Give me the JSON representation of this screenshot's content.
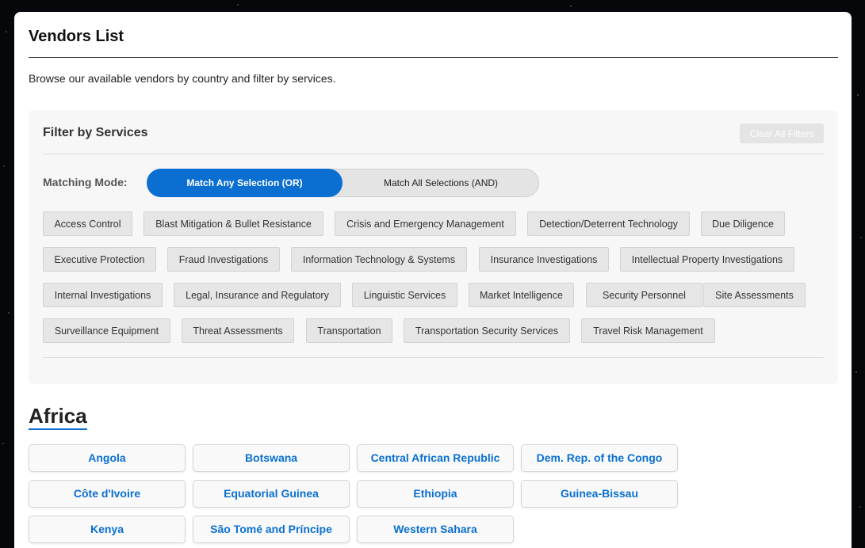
{
  "page": {
    "title": "Vendors List",
    "intro": "Browse our available vendors by country and filter by services."
  },
  "filter": {
    "title": "Filter by Services",
    "clear_label": "Clear All Filters",
    "mode_label": "Matching Mode:",
    "mode_or_label": "Match Any Selection (OR)",
    "mode_and_label": "Match All Selections (AND)",
    "active_mode": "OR",
    "services": [
      "Access Control",
      "Blast Mitigation & Bullet Resistance",
      "Crisis and Emergency Management",
      "Detection/Deterrent Technology",
      "Due Diligence",
      "Executive Protection",
      "Fraud Investigations",
      "Information Technology & Systems",
      "Insurance Investigations",
      "Intellectual Property Investigations",
      "Internal Investigations",
      "Legal, Insurance and Regulatory",
      "Linguistic Services",
      "Market Intelligence",
      "Security Personnel",
      "Site Assessments",
      "Surveillance Equipment",
      "Threat Assessments",
      "Transportation",
      "Transportation Security Services",
      "Travel Risk Management"
    ]
  },
  "regions": [
    {
      "name": "Africa",
      "countries": [
        "Angola",
        "Botswana",
        "Central African Republic",
        "Dem. Rep. of the Congo",
        "Côte d'Ivoire",
        "Equatorial Guinea",
        "Ethiopia",
        "Guinea-Bissau",
        "Kenya",
        "São Tomé and Príncipe",
        "Western Sahara"
      ]
    }
  ],
  "colors": {
    "accent": "#0a6fd1",
    "tag_bg": "#e6e6e6",
    "panel_bg": "#ffffff",
    "page_bg": "#05070a"
  }
}
